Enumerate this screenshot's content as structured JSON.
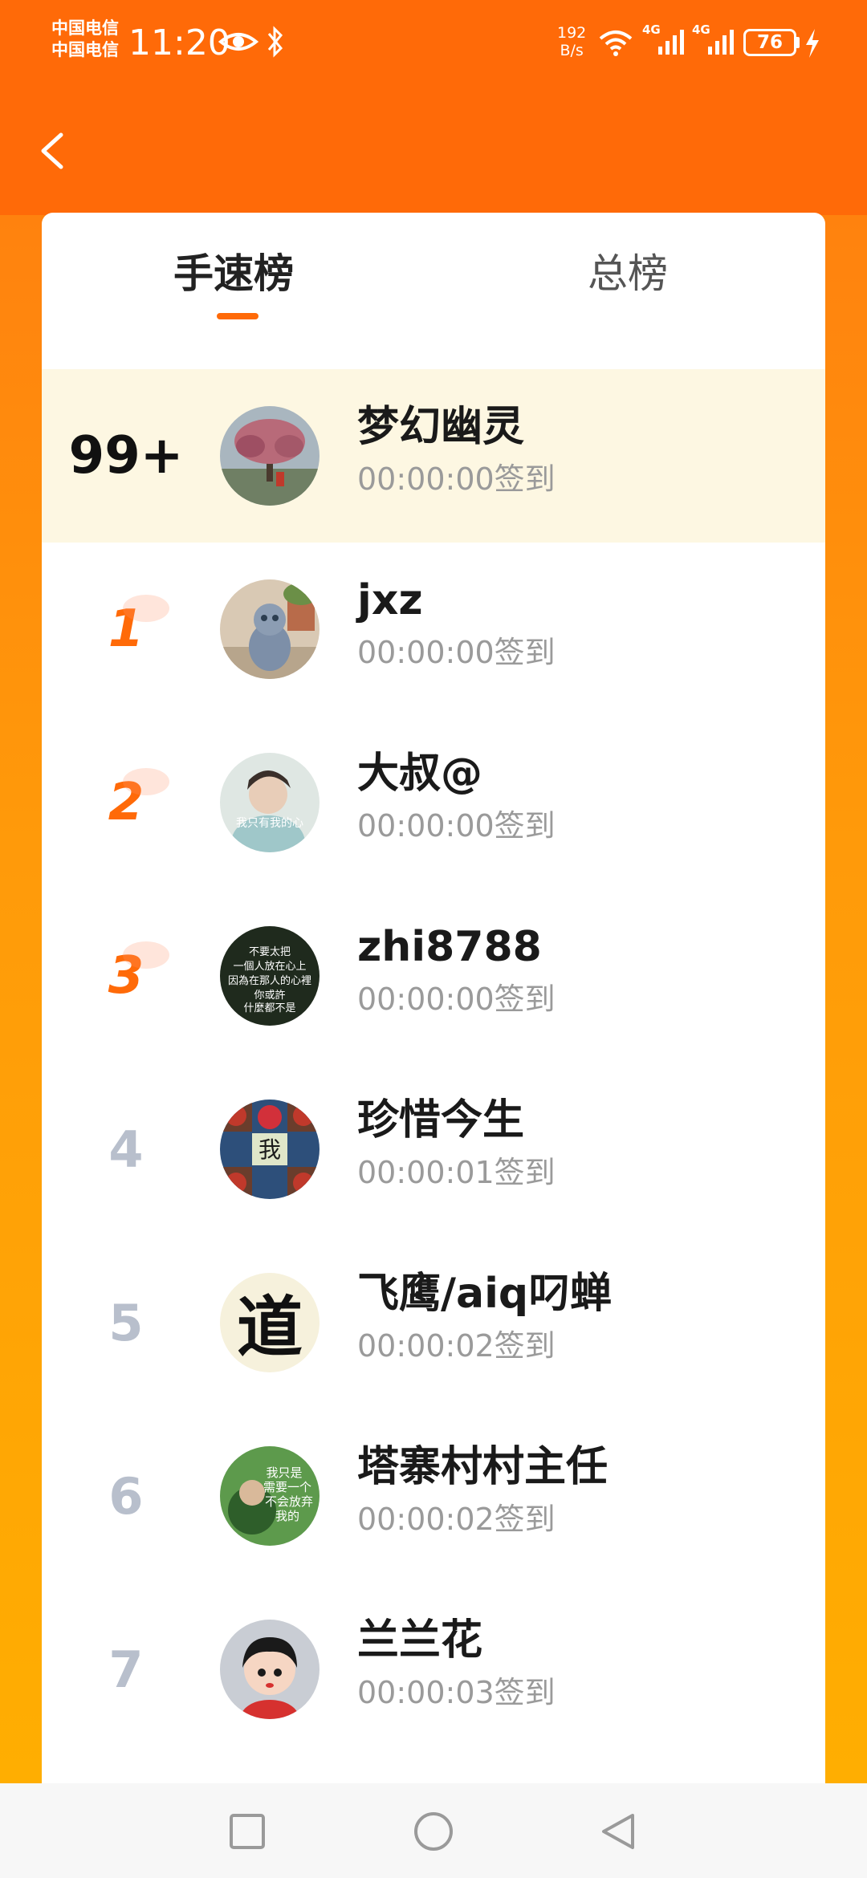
{
  "status_bar": {
    "carrier_1": "中国电信",
    "carrier_2": "中国电信",
    "time": "11:20",
    "net_speed_value": "192",
    "net_speed_unit": "B/s",
    "signal_1_label": "4G",
    "signal_2_label": "4G",
    "battery": "76",
    "icons": [
      "eye-icon",
      "bluetooth-icon",
      "wifi-icon",
      "signal-icon",
      "signal-icon",
      "battery-icon",
      "charging-icon"
    ]
  },
  "header": {
    "back_icon": "chevron-left-icon"
  },
  "tabs": [
    {
      "label": "手速榜",
      "active": true
    },
    {
      "label": "总榜",
      "active": false
    }
  ],
  "my_entry": {
    "rank": "99+",
    "name": "梦幻幽灵",
    "time": "00:00:00签到"
  },
  "entries": [
    {
      "rank": "1",
      "name": "jxz",
      "time": "00:00:00签到"
    },
    {
      "rank": "2",
      "name": "大叔@",
      "time": "00:00:00签到"
    },
    {
      "rank": "3",
      "name": "zhi8788",
      "time": "00:00:00签到"
    },
    {
      "rank": "4",
      "name": "珍惜今生",
      "time": "00:00:01签到"
    },
    {
      "rank": "5",
      "name": "飞鹰/aiq叼蝉",
      "time": "00:00:02签到"
    },
    {
      "rank": "6",
      "name": "塔寨村村主任",
      "time": "00:00:02签到"
    },
    {
      "rank": "7",
      "name": "兰兰花",
      "time": "00:00:03签到"
    }
  ],
  "avatar_texts": {
    "dashu": "我只有我的心",
    "zhi_lines": [
      "不要太把",
      "一個人放在心上",
      "因為在那人的心裡",
      "你或許",
      "什麼都不是"
    ],
    "zhenxi": "我",
    "feiying": "道",
    "tazhai_lines": [
      "我只是",
      "需要一个",
      "不会放弃",
      "我的"
    ]
  },
  "nav": {
    "icons": [
      "recent-apps-icon",
      "home-icon",
      "back-icon"
    ]
  },
  "colors": {
    "accent": "#ff6a08",
    "highlight_row": "#fdf7e2",
    "muted_rank": "#b8bfcc"
  }
}
